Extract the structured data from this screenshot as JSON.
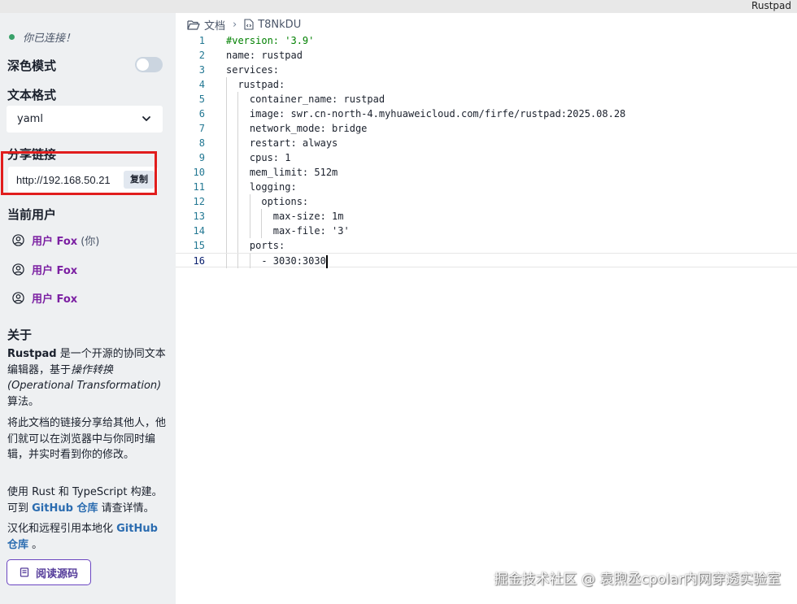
{
  "app": {
    "title": "Rustpad"
  },
  "sidebar": {
    "connection_status": "你已连接！",
    "dark_mode_label": "深色模式",
    "text_format_label": "文本格式",
    "language_value": "yaml",
    "share_link_label": "分享链接",
    "share_link_value": "http://192.168.50.21",
    "copy_button": "复制",
    "current_users_label": "当前用户",
    "users": [
      {
        "name": "用户 Fox",
        "suffix": "(你)"
      },
      {
        "name": "用户 Fox",
        "suffix": ""
      },
      {
        "name": "用户 Fox",
        "suffix": ""
      }
    ],
    "about": {
      "heading": "关于",
      "p1_bold": "Rustpad",
      "p1_text_a": " 是一个开源的协同文本编辑器，基于",
      "p1_italic": "操作转换 (Operational Transformation)",
      "p1_text_b": "算法。",
      "p2": "将此文档的链接分享给其他人，他们就可以在浏览器中与你同时编辑，并实时看到你的修改。",
      "p3_a": "使用 Rust 和 TypeScript 构建。可到 ",
      "p3_link": "GitHub 仓库",
      "p3_b": " 请查详情。",
      "p4_a": "汉化和远程引用本地化 ",
      "p4_link": "GitHub 仓库",
      "p4_b": " 。"
    },
    "read_source_button": "阅读源码"
  },
  "breadcrumb": {
    "folder": "文档",
    "document": "T8NkDU"
  },
  "editor": {
    "lines": [
      {
        "num": "1",
        "text": "#version: '3.9'"
      },
      {
        "num": "2",
        "text": "name: rustpad"
      },
      {
        "num": "3",
        "text": "services:"
      },
      {
        "num": "4",
        "text": "  rustpad:"
      },
      {
        "num": "5",
        "text": "    container_name: rustpad"
      },
      {
        "num": "6",
        "text": "    image: swr.cn-north-4.myhuaweicloud.com/firfe/rustpad:2025.08.28"
      },
      {
        "num": "7",
        "text": "    network_mode: bridge"
      },
      {
        "num": "8",
        "text": "    restart: always"
      },
      {
        "num": "9",
        "text": "    cpus: 1"
      },
      {
        "num": "10",
        "text": "    mem_limit: 512m"
      },
      {
        "num": "11",
        "text": "    logging:"
      },
      {
        "num": "12",
        "text": "      options:"
      },
      {
        "num": "13",
        "text": "        max-size: 1m"
      },
      {
        "num": "14",
        "text": "        max-file: '3'"
      },
      {
        "num": "15",
        "text": "    ports:"
      },
      {
        "num": "16",
        "text": "      - 3030:3030"
      }
    ],
    "current_line": "16"
  },
  "watermark": "掘金技术社区 @ 袁煦丞cpolar内网穿透实验室",
  "colors": {
    "user_name": "#7b1fa2",
    "link": "#2b6cb0",
    "highlight_box": "#e11d1d",
    "connected_dot": "#38a169"
  }
}
